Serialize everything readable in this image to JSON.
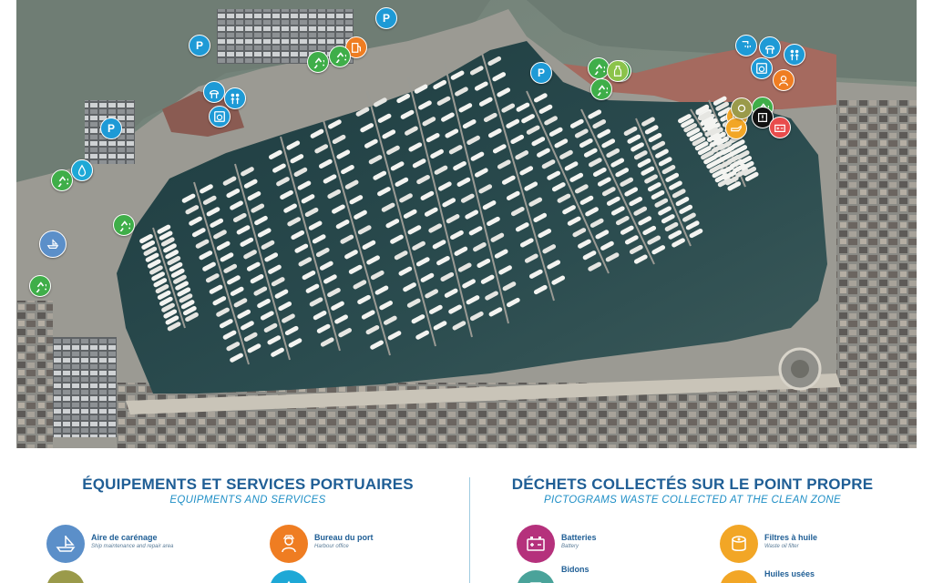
{
  "map": {
    "markers": [
      {
        "name": "parking-marker",
        "label": "P",
        "icon": "parking-icon",
        "color": "#1e9ad6"
      },
      {
        "name": "parking-marker",
        "label": "P",
        "icon": "parking-icon",
        "color": "#1e9ad6"
      },
      {
        "name": "parking-marker",
        "label": "P",
        "icon": "parking-icon",
        "color": "#1e9ad6"
      },
      {
        "name": "parking-marker",
        "label": "P",
        "icon": "parking-icon",
        "color": "#1e9ad6"
      },
      {
        "name": "sanitary-marker",
        "label": "",
        "icon": "sanitary-icon",
        "color": "#1e9ad6"
      },
      {
        "name": "toilets-marker",
        "label": "",
        "icon": "toilets-icon",
        "color": "#1e9ad6"
      },
      {
        "name": "laundry-marker",
        "label": "",
        "icon": "laundry-icon",
        "color": "#1e9ad6"
      },
      {
        "name": "info-marker",
        "label": "",
        "icon": "info-icon",
        "color": "#1e9ad6"
      },
      {
        "name": "shower-marker",
        "label": "",
        "icon": "shower-icon",
        "color": "#1e9ad6"
      },
      {
        "name": "sanitary-marker",
        "label": "",
        "icon": "sanitary-icon",
        "color": "#1e9ad6"
      },
      {
        "name": "laundry-marker",
        "label": "",
        "icon": "laundry-icon",
        "color": "#1e9ad6"
      },
      {
        "name": "toilets-marker",
        "label": "",
        "icon": "toilets-icon",
        "color": "#1e9ad6"
      },
      {
        "name": "harbour-office-marker",
        "label": "",
        "icon": "harbour-master-icon",
        "color": "#ef7d22"
      },
      {
        "name": "fuel-marker",
        "label": "",
        "icon": "fuel-icon",
        "color": "#ef7d22"
      },
      {
        "name": "oil-filter-marker",
        "label": "",
        "icon": "oil-filter-icon",
        "color": "#f2a626"
      },
      {
        "name": "used-oil-marker",
        "label": "",
        "icon": "used-oil-icon",
        "color": "#f2a626"
      },
      {
        "name": "recycling-marker",
        "label": "",
        "icon": "recycling-icon",
        "color": "#3fae49"
      },
      {
        "name": "recycling-marker",
        "label": "",
        "icon": "recycling-icon",
        "color": "#3fae49"
      },
      {
        "name": "recycling-marker",
        "label": "",
        "icon": "recycling-icon",
        "color": "#3fae49"
      },
      {
        "name": "recycling-marker",
        "label": "",
        "icon": "recycling-icon",
        "color": "#3fae49"
      },
      {
        "name": "recycling-marker",
        "label": "",
        "icon": "recycling-icon",
        "color": "#3fae49"
      },
      {
        "name": "recycling-marker",
        "label": "",
        "icon": "recycling-icon",
        "color": "#3fae49"
      },
      {
        "name": "recycling-marker",
        "label": "",
        "icon": "recycling-icon",
        "color": "#3fae49"
      },
      {
        "name": "recycling-marker",
        "label": "",
        "icon": "recycling-icon",
        "color": "#3fae49"
      },
      {
        "name": "recycling-marker",
        "label": "",
        "icon": "recycling-icon",
        "color": "#3fae49"
      },
      {
        "name": "glass-marker",
        "label": "",
        "icon": "glass-icon",
        "color": "#8bc34a"
      },
      {
        "name": "other-waste-marker",
        "label": "",
        "icon": "other-waste-icon",
        "color": "#9a9a4a"
      },
      {
        "name": "hazardous-waste-marker",
        "label": "",
        "icon": "hazardous-waste-icon",
        "color": "#111111"
      },
      {
        "name": "battery-marker",
        "label": "",
        "icon": "battery-icon",
        "color": "#e84c4c"
      },
      {
        "name": "water-point-marker",
        "label": "",
        "icon": "water-drop-icon",
        "color": "#1ea8d6"
      },
      {
        "name": "careening-area-marker",
        "label": "",
        "icon": "careening-icon",
        "color": "#5b8fc9"
      }
    ]
  },
  "legend": {
    "left": {
      "title": "ÉQUIPEMENTS ET SERVICES PORTUAIRES",
      "subtitle": "EQUIPMENTS AND SERVICES",
      "items": [
        {
          "name": "Aire de carénage",
          "sub": "Ship maintenance and repair area",
          "icon": "careening-icon",
          "color": "#5b8fc9"
        },
        {
          "name": "Bureau du port",
          "sub": "Harbour office",
          "icon": "harbour-master-icon",
          "color": "#ef7d22"
        },
        {
          "name": "",
          "sub": "",
          "icon": "other-waste-icon",
          "color": "#9a9a4a"
        },
        {
          "name": "",
          "sub": "",
          "icon": "water-point-icon",
          "color": "#1ea8d6"
        }
      ]
    },
    "right": {
      "title": "DÉCHETS COLLECTÉS SUR LE POINT PROPRE",
      "subtitle": "PICTOGRAMS WASTE COLLECTED AT THE CLEAN ZONE",
      "items": [
        {
          "name": "Batteries",
          "sub": "Battery",
          "icon": "battery-icon",
          "color": "#b5317c"
        },
        {
          "name": "Filtres à huile",
          "sub": "Waste oil filter",
          "icon": "oil-filter-icon",
          "color": "#f2a626"
        },
        {
          "name": "Bidons",
          "sub": "",
          "icon": "can-icon",
          "color": "#4aa39a"
        },
        {
          "name": "Huiles usées",
          "sub": "",
          "icon": "used-oil-icon",
          "color": "#f2a626"
        }
      ]
    }
  }
}
